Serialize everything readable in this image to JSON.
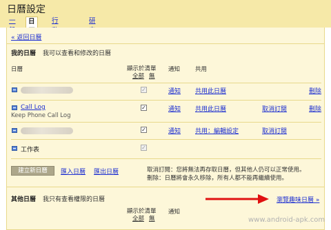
{
  "header": {
    "title": "日曆設定"
  },
  "tabs": [
    "一般",
    "日曆",
    "行動設定",
    "研究室"
  ],
  "back_link": "« 返回日曆",
  "my_calendars": {
    "title": "我的日曆",
    "description": "我可以查看和修改的日曆",
    "col_calendar": "日曆",
    "col_show_in_list": "顯示於清單",
    "col_all": "全部",
    "col_none": "無",
    "col_notify": "通知",
    "col_share": "共用",
    "rows": [
      {
        "name": "",
        "subtitle": "",
        "notify": "通知",
        "share": "共用此日曆",
        "unsubscribe": "",
        "delete": "刪除",
        "checked": true,
        "disabled": true
      },
      {
        "name": "Call Log",
        "subtitle": "Keep Phone Call Log",
        "notify": "通知",
        "share": "共用此日曆",
        "unsubscribe": "取消訂閱",
        "delete": "刪除",
        "checked": true,
        "disabled": false
      },
      {
        "name": "",
        "subtitle": "",
        "notify": "通知",
        "share": "共用：編輯設定",
        "unsubscribe": "取消訂閱",
        "delete": "",
        "checked": true,
        "disabled": false
      },
      {
        "name": "工作表",
        "subtitle": "",
        "notify": "",
        "share": "",
        "unsubscribe": "",
        "delete": "",
        "checked": true,
        "disabled": true
      }
    ],
    "create_button": "建立新日曆",
    "import_link": "匯入日曆",
    "export_link": "匯出日曆",
    "note_line1": "取消訂閱：您將無法再存取日曆，但其他人仍可以正常使用。",
    "note_line2": "刪除：日曆將會永久移除，所有人都不能再繼續使用。"
  },
  "other_calendars": {
    "title": "其他日曆",
    "description": "我只有查看權限的日曆",
    "browse_link": "瀏覽趣味日曆 »",
    "col_show_in_list": "顯示於清單",
    "col_all": "全部",
    "col_none": "無",
    "col_notify": "通知"
  },
  "watermark": "www.android-apk.com",
  "colors": {
    "header_bg": "#f6e9a8",
    "panel_bg": "#fdf7d9",
    "link": "#1d2fd1",
    "arrow": "#e01010"
  }
}
